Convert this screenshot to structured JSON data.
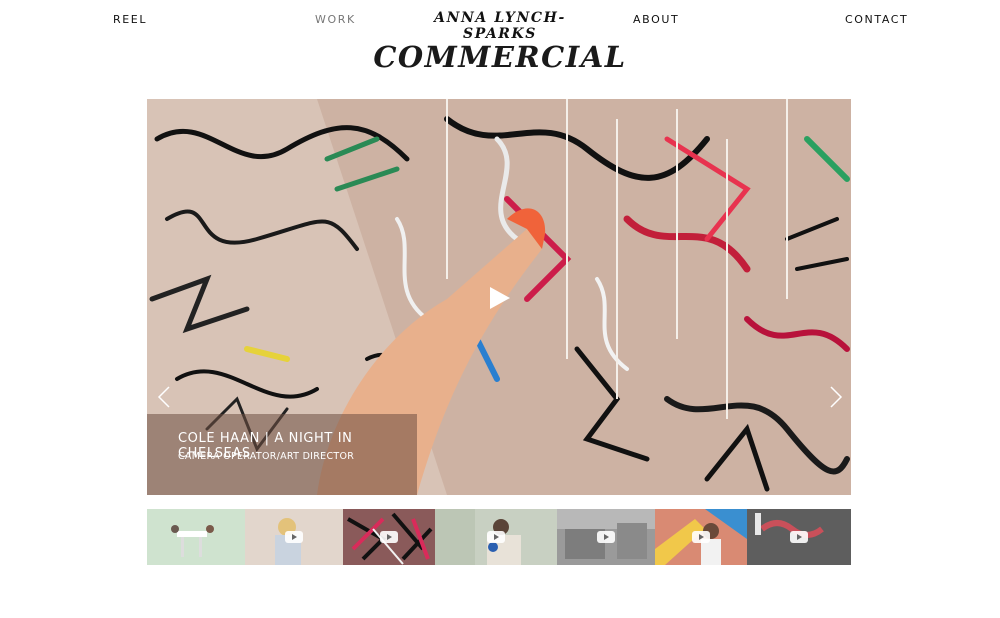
{
  "nav": {
    "reel": "REEL",
    "work": "WORK",
    "brand": "ANNA LYNCH-SPARKS",
    "about": "ABOUT",
    "contact": "CONTACT"
  },
  "page": {
    "title": "COMMERCIAL"
  },
  "slide": {
    "title": "COLE HAAN | A NIGHT IN CHELSEAS",
    "subtitle": "CAMERA OPERATOR/ART DIRECTOR"
  },
  "thumbnails": [
    {
      "icon": "none",
      "color": "#cfe3cf"
    },
    {
      "icon": "youtube-play-icon",
      "color": "#e2d6cc"
    },
    {
      "icon": "youtube-play-icon",
      "color": "#8a5a5a"
    },
    {
      "icon": "youtube-play-icon",
      "color": "#c8d0c2"
    },
    {
      "icon": "youtube-play-icon",
      "color": "#9a9a9a"
    },
    {
      "icon": "youtube-play-icon",
      "color": "#d98a73"
    },
    {
      "icon": "youtube-play-icon",
      "color": "#6c6c6c"
    }
  ]
}
